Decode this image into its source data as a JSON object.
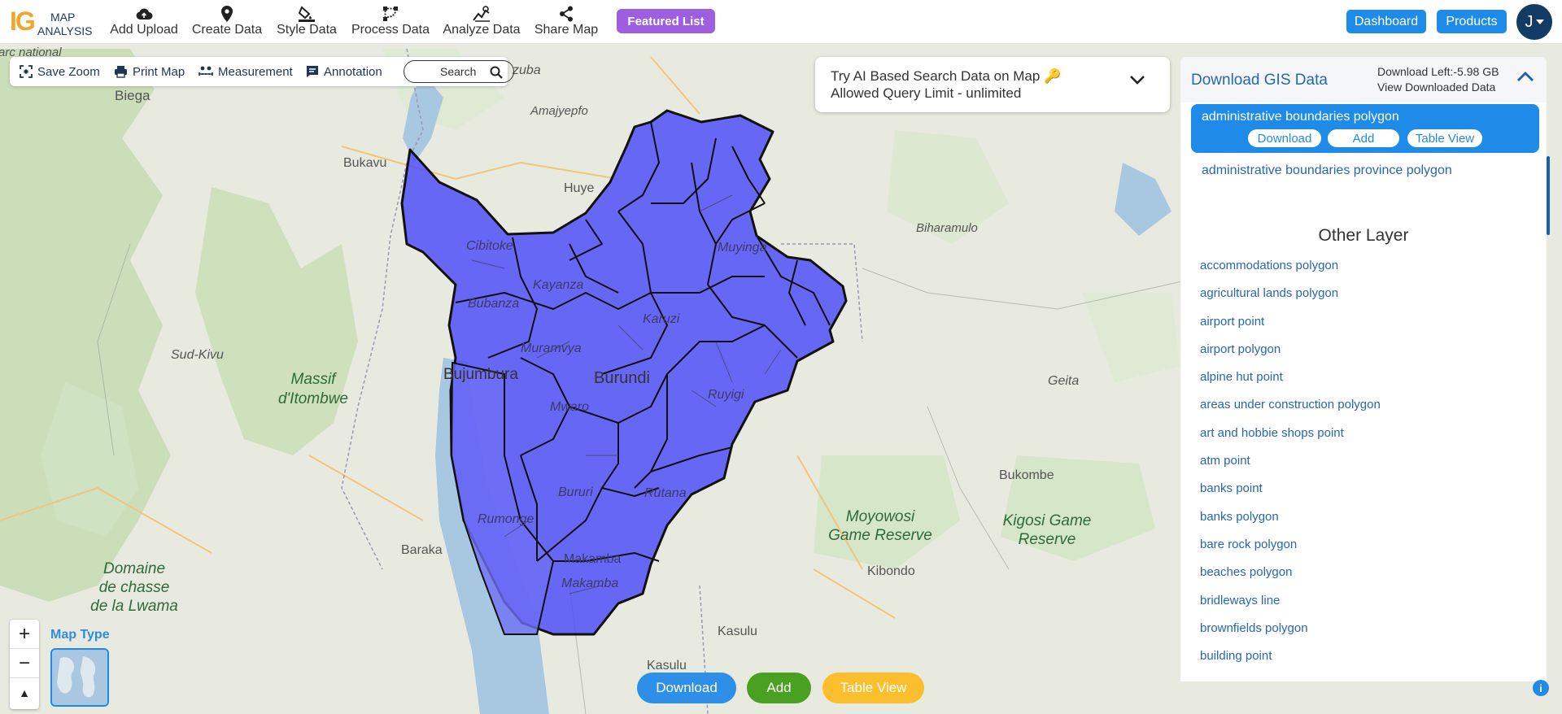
{
  "nav": {
    "logo_letters": "IG",
    "logo_line1": "MAP",
    "logo_line2": "ANALYSIS",
    "items": [
      {
        "label": "Add Upload",
        "icon": "cloud-upload-icon"
      },
      {
        "label": "Create Data",
        "icon": "map-pin-icon"
      },
      {
        "label": "Style Data",
        "icon": "paint-bucket-icon"
      },
      {
        "label": "Process Data",
        "icon": "process-nodes-icon"
      },
      {
        "label": "Analyze Data",
        "icon": "analyze-chart-icon"
      },
      {
        "label": "Share Map",
        "icon": "share-icon"
      }
    ],
    "featured": "Featured List",
    "dashboard": "Dashboard",
    "products": "Products",
    "avatar": "J"
  },
  "toolbar": {
    "save_zoom": "Save Zoom",
    "print_map": "Print Map",
    "measurement": "Measurement",
    "annotation": "Annotation",
    "search": "Search"
  },
  "ai_search": {
    "line1": "Try AI Based Search Data on Map 🔑",
    "line2": "Allowed Query Limit - unlimited"
  },
  "panel": {
    "title": "Download GIS Data",
    "download_left": "Download Left:-5.98 GB",
    "view_downloaded": "View Downloaded Data",
    "selected_layer": "administrative boundaries polygon",
    "btn_download": "Download",
    "btn_add": "Add",
    "btn_table": "Table View",
    "layer2": "administrative boundaries province polygon",
    "other_title": "Other Layer",
    "other_layers": [
      "accommodations polygon",
      "agricultural lands polygon",
      "airport point",
      "airport polygon",
      "alpine hut point",
      "areas under construction polygon",
      "art and hobbie shops point",
      "atm point",
      "banks point",
      "banks polygon",
      "bare rock polygon",
      "beaches polygon",
      "bridleways line",
      "brownfields polygon",
      "building point"
    ]
  },
  "map": {
    "labels": {
      "biega": "Biega",
      "bukavu": "Bukavu",
      "huye": "Huye",
      "zuba": "zuba",
      "amajyepfo": "Amajyepfo",
      "sudkivu": "Sud-Kivu",
      "massif": "Massif",
      "itombwe": "d'Itombwe",
      "biharamulo": "Biharamulo",
      "geita": "Geita",
      "bukombe": "Bukombe",
      "moyowosi1": "Moyowosi",
      "moyowosi2": "Game Reserve",
      "kigosi1": "Kigosi Game",
      "kigosi2": "Reserve",
      "kibondo": "Kibondo",
      "baraka": "Baraka",
      "domaine1": "Domaine",
      "domaine2": "de chasse",
      "domaine3": "de la Lwama",
      "kasulu": "Kasulu",
      "kasulu2": "Kasulu",
      "cibitoke": "Cibitoke",
      "kayanza": "Kayanza",
      "bubanza": "Bubanza",
      "muramvya": "Muramvya",
      "karuzi": "Karuzi",
      "bujumbura": "Bujumbura",
      "burundi": "Burundi",
      "mwaro": "Mwaro",
      "ruyigi": "Ruyigi",
      "bururi": "Bururi",
      "rutana": "Rutana",
      "rumonge": "Rumonge",
      "makamba": "Makamba",
      "makamba2": "Makamba",
      "muyinga": "Muyinga",
      "parc": "Parc national"
    },
    "map_type": "Map Type",
    "zoom_in": "+",
    "zoom_out": "−",
    "compass": "▲",
    "polygon_color": "#4b4bfa"
  },
  "bottom": {
    "download": "Download",
    "add": "Add",
    "table_view": "Table View",
    "info": "i"
  }
}
